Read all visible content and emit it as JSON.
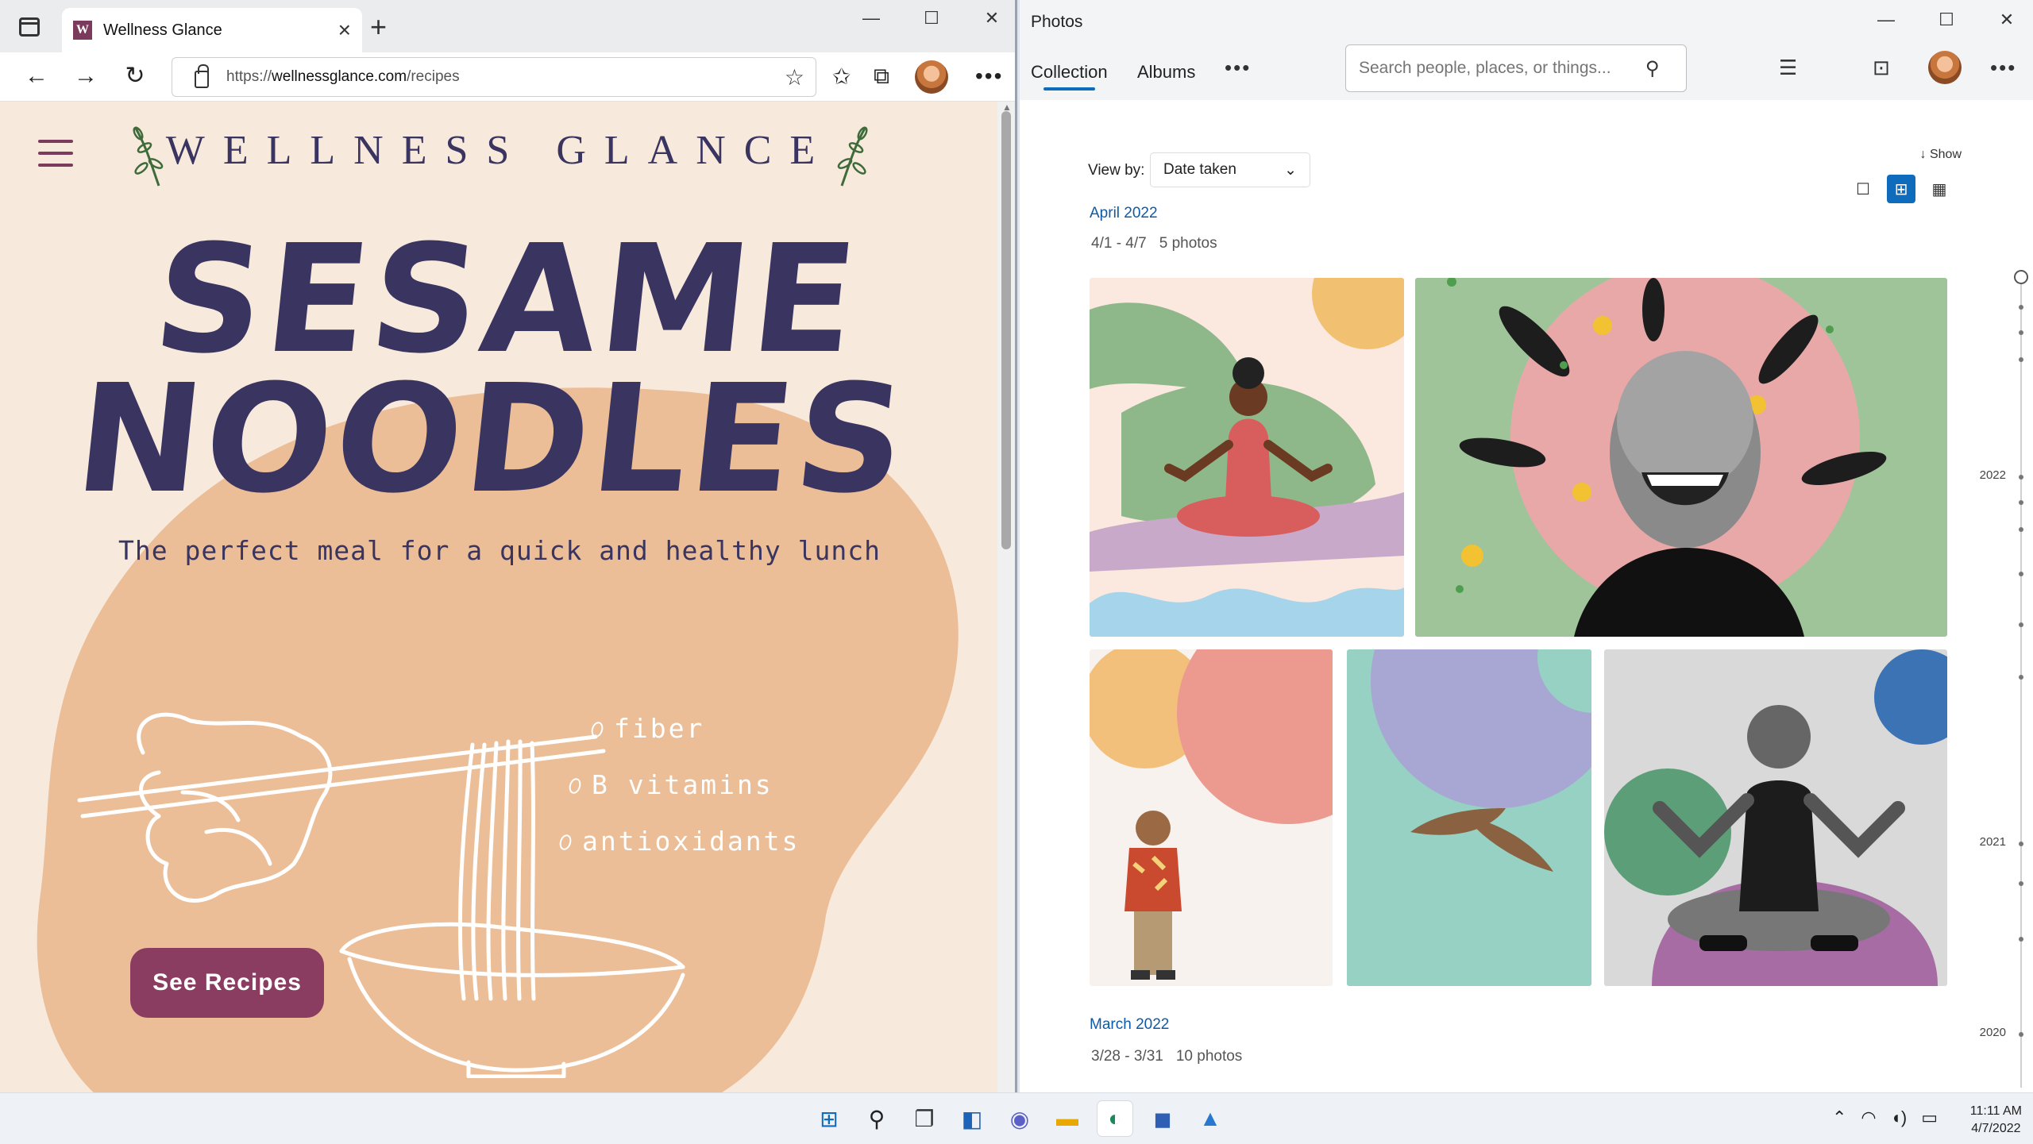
{
  "edge": {
    "tab_title": "Wellness Glance",
    "favicon_letter": "W",
    "tab_close": "×",
    "new_tab": "+",
    "url_prefix": "https://",
    "url_domain": "wellnessglance.com",
    "url_path": "/recipes",
    "controls": {
      "minimize": "—",
      "maximize": "☐",
      "close": "✕"
    },
    "toolbar_icons": [
      "back-icon",
      "forward-icon",
      "refresh-icon",
      "lock-icon",
      "add-favorite-icon",
      "favorites-icon",
      "collections-icon",
      "profile-avatar",
      "more-icon"
    ]
  },
  "page": {
    "brand": "WELLNESS GLANCE",
    "title_line1": "SESAME",
    "title_line2": "NOODLES",
    "subtitle": "The perfect meal for a quick and healthy lunch",
    "facts": [
      "fiber",
      "B vitamins",
      "antioxidants"
    ],
    "cta": "See Recipes",
    "colors": {
      "background": "#f7eadd",
      "blob": "#ebbe97",
      "navy": "#3a3460",
      "plum": "#8b3d61"
    }
  },
  "photos": {
    "app_title": "Photos",
    "controls": {
      "minimize": "—",
      "maximize": "☐",
      "close": "✕"
    },
    "tabs": [
      "Collection",
      "Albums"
    ],
    "more": "•••",
    "search_placeholder": "Search people, places, or things...",
    "view_by_label": "View by:",
    "view_by_value": "Date taken",
    "show_label": "Show",
    "groups": [
      {
        "title": "April 2022",
        "range": "4/1 - 4/7",
        "count": "5 photos"
      },
      {
        "title": "March 2022",
        "range": "3/28 - 3/31",
        "count": "10 photos"
      }
    ],
    "timeline_years": [
      "2022",
      "2021",
      "2020"
    ],
    "accent": "#0f6cbd"
  },
  "taskbar": {
    "apps": [
      "windows-start-icon",
      "search-icon",
      "task-view-icon",
      "widgets-icon",
      "teams-chat-icon",
      "file-explorer-icon",
      "edge-icon",
      "store-icon",
      "photos-icon"
    ],
    "time": "11:11 AM",
    "date": "4/7/2022"
  }
}
